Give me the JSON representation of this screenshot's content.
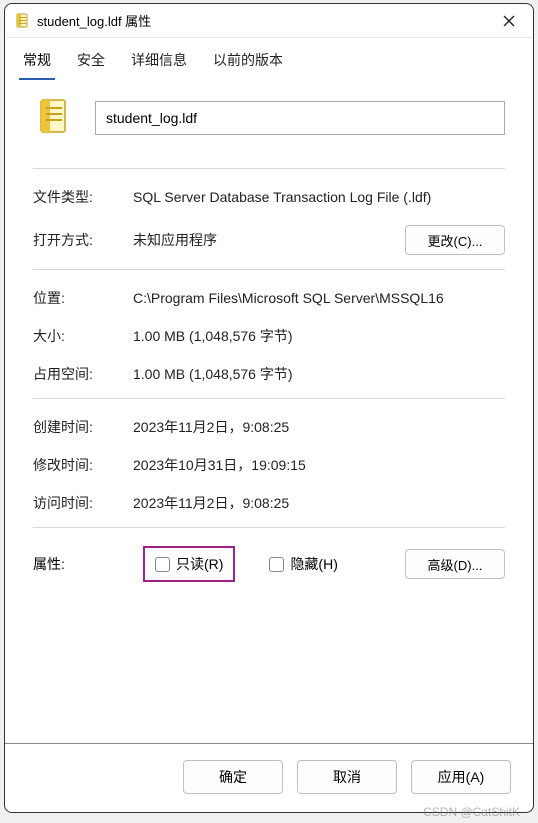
{
  "window": {
    "title": "student_log.ldf 属性"
  },
  "tabs": [
    {
      "label": "常规",
      "active": true
    },
    {
      "label": "安全",
      "active": false
    },
    {
      "label": "详细信息",
      "active": false
    },
    {
      "label": "以前的版本",
      "active": false
    }
  ],
  "filename": "student_log.ldf",
  "general": {
    "filetype_label": "文件类型:",
    "filetype_value": "SQL Server Database Transaction Log File (.ldf)",
    "openwith_label": "打开方式:",
    "openwith_value": "未知应用程序",
    "change_button": "更改(C)...",
    "location_label": "位置:",
    "location_value": "C:\\Program Files\\Microsoft SQL Server\\MSSQL16",
    "size_label": "大小:",
    "size_value": "1.00 MB (1,048,576 字节)",
    "disk_label": "占用空间:",
    "disk_value": "1.00 MB (1,048,576 字节)",
    "created_label": "创建时间:",
    "created_value": "2023‎年‎11‎月‎2‎日，‏‎9:08:25",
    "modified_label": "修改时间:",
    "modified_value": "2023‎年‎10‎月‎31‎日，‏‎19:09:15",
    "accessed_label": "访问时间:",
    "accessed_value": "2023‎年‎11‎月‎2‎日，‏‎9:08:25",
    "attributes_label": "属性:",
    "readonly_label": "只读(R)",
    "hidden_label": "隐藏(H)",
    "advanced_button": "高级(D)..."
  },
  "footer": {
    "ok": "确定",
    "cancel": "取消",
    "apply": "应用(A)"
  },
  "watermark": "CSDN @CatShitK"
}
